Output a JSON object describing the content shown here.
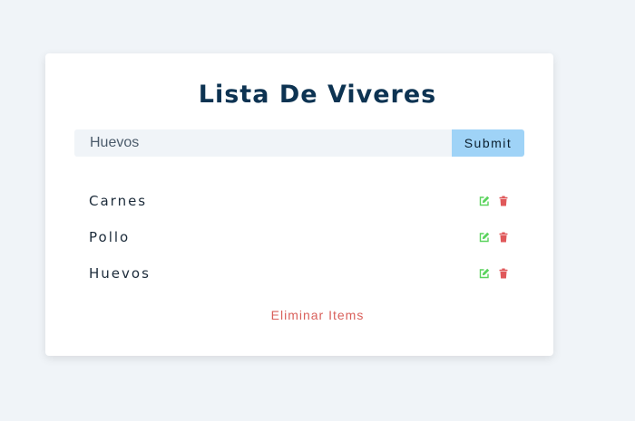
{
  "app": {
    "title": "Lista De Viveres"
  },
  "form": {
    "input_value": "Huevos",
    "submit_label": "Submit"
  },
  "items": [
    {
      "name": "Carnes",
      "edit_icon": "edit-icon",
      "delete_icon": "trash-icon"
    },
    {
      "name": "Pollo",
      "edit_icon": "edit-icon",
      "delete_icon": "trash-icon"
    },
    {
      "name": "Huevos",
      "edit_icon": "edit-icon",
      "delete_icon": "trash-icon"
    }
  ],
  "clear_label": "Eliminar Items",
  "colors": {
    "background": "#f0f4f8",
    "card": "#ffffff",
    "title": "#0d3352",
    "submit": "#9fd3f7",
    "edit_icon": "#5ad35d",
    "delete_icon": "#e0585a",
    "clear_text": "#d9605b"
  }
}
